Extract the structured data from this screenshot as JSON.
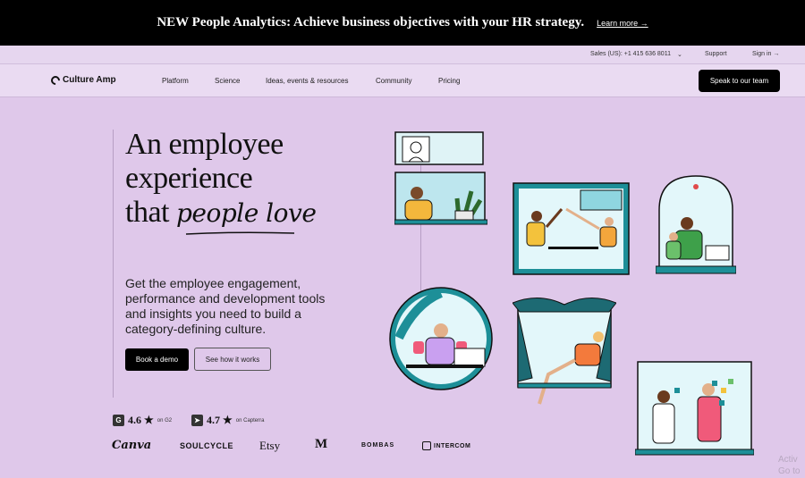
{
  "banner": {
    "text": "NEW People Analytics: Achieve business objectives with your HR strategy.",
    "link": "Learn more →"
  },
  "utility": {
    "sales": "Sales (US): +1 415 636 8011",
    "support": "Support",
    "signin": "Sign in →"
  },
  "nav": {
    "logo": "Culture Amp",
    "items": [
      "Platform",
      "Science",
      "Ideas, events & resources",
      "Community",
      "Pricing"
    ],
    "cta": "Speak to our team"
  },
  "hero": {
    "line1": "An employee",
    "line2": "experience",
    "line3": "that",
    "line3_script": "people love",
    "subtext": "Get the employee engagement, performance and development tools and insights you need to build a category-defining culture.",
    "primary_cta": "Book a demo",
    "secondary_cta": "See how it works"
  },
  "ratings": [
    {
      "badge": "G",
      "score": "4.6 ★",
      "source": "on G2"
    },
    {
      "badge": "➤",
      "score": "4.7 ★",
      "source": "on Capterra"
    }
  ],
  "customers": [
    "Canva",
    "SOULCYCLE",
    "Etsy",
    "M",
    "BOMBAS",
    "INTERCOM"
  ],
  "watermark": {
    "line1": "Activ",
    "line2": "Go to"
  },
  "colors": {
    "background": "#dfc8ea",
    "banner": "#000000",
    "teal": "#1d8f98",
    "accent_dark": "#000000"
  }
}
